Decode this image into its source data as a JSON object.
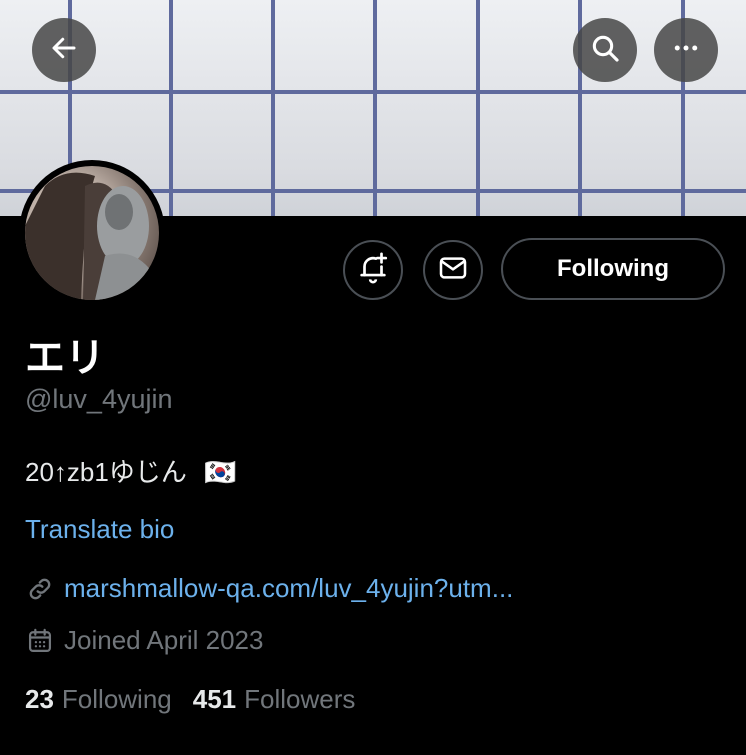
{
  "header": {
    "back_icon": "arrow-left-icon",
    "search_icon": "search-icon",
    "more_icon": "more-horizontal-icon"
  },
  "profile": {
    "display_name": "エリ",
    "handle": "@luv_4yujin",
    "bio": "20↑zb1ゆじん",
    "bio_flag": "🇰🇷",
    "translate_label": "Translate bio",
    "link": "marshmallow-qa.com/luv_4yujin?utm...",
    "joined": "Joined April 2023"
  },
  "actions": {
    "notify_icon": "bell-plus-icon",
    "message_icon": "envelope-icon",
    "following_label": "Following"
  },
  "stats": {
    "following_count": "23",
    "following_label": "Following",
    "followers_count": "451",
    "followers_label": "Followers"
  },
  "colors": {
    "background": "#000000",
    "link": "#6cb1ec",
    "muted": "#71767b",
    "banner_grid": "#5f6a9d"
  }
}
